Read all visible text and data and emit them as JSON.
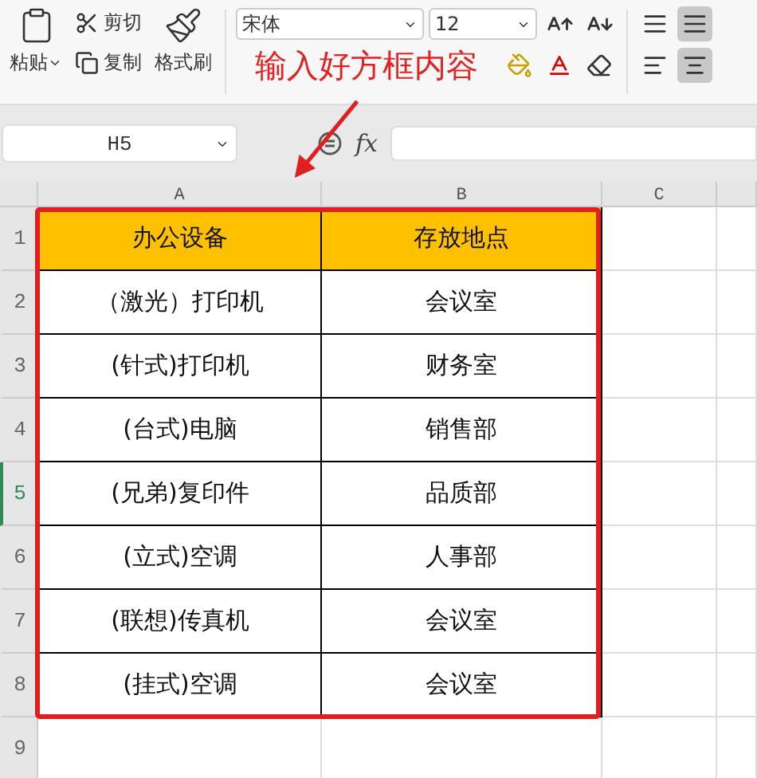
{
  "toolbar": {
    "paste": "粘贴",
    "cut": "剪切",
    "copy": "复制",
    "format_painter": "格式刷",
    "font_name": "宋体",
    "font_size": "12"
  },
  "annotation": {
    "text": "输入好方框内容"
  },
  "formula_bar": {
    "name_box": "H5",
    "fx": "fx"
  },
  "columns": [
    "A",
    "B",
    "C"
  ],
  "rows": [
    {
      "number": "1",
      "kind": "header",
      "selected": false,
      "cells": [
        "办公设备",
        "存放地点"
      ]
    },
    {
      "number": "2",
      "kind": "data",
      "selected": false,
      "cells": [
        "（激光）打印机",
        "会议室"
      ]
    },
    {
      "number": "3",
      "kind": "data",
      "selected": false,
      "cells": [
        "(针式)打印机",
        "财务室"
      ]
    },
    {
      "number": "4",
      "kind": "data",
      "selected": false,
      "cells": [
        "(台式)电脑",
        "销售部"
      ]
    },
    {
      "number": "5",
      "kind": "data",
      "selected": true,
      "cells": [
        "(兄弟)复印件",
        "品质部"
      ]
    },
    {
      "number": "6",
      "kind": "data",
      "selected": false,
      "cells": [
        "(立式)空调",
        "人事部"
      ]
    },
    {
      "number": "7",
      "kind": "data",
      "selected": false,
      "cells": [
        "(联想)传真机",
        "会议室"
      ]
    },
    {
      "number": "8",
      "kind": "data",
      "selected": false,
      "cells": [
        "(挂式)空调",
        "会议室"
      ]
    },
    {
      "number": "9",
      "kind": "empty",
      "selected": false,
      "cells": []
    }
  ]
}
